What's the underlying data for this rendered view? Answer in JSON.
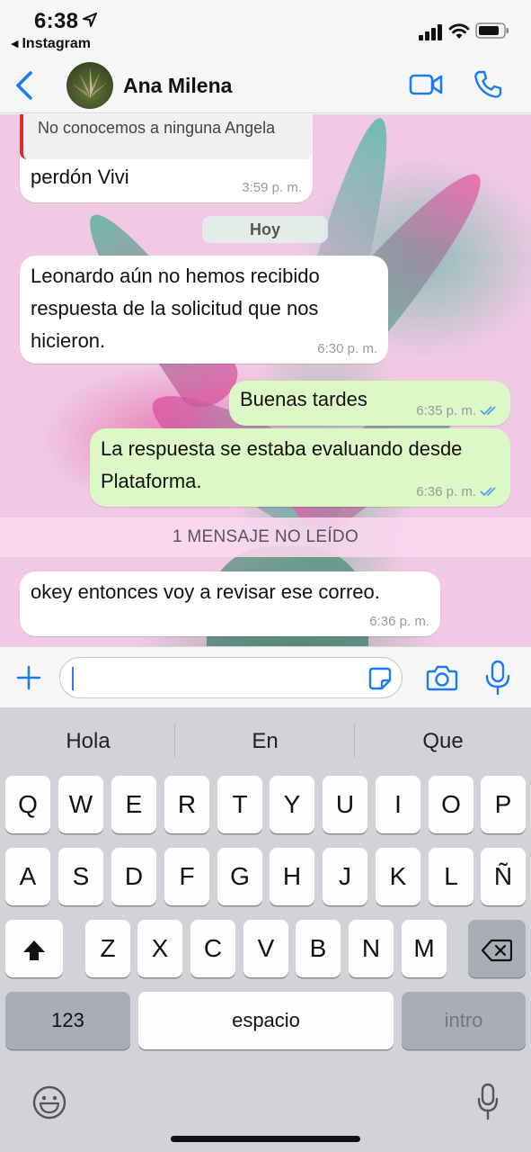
{
  "status_bar": {
    "time": "6:38",
    "back_app": "Instagram"
  },
  "header": {
    "contact_name": "Ana Milena"
  },
  "chat": {
    "quoted_text": "No conocemos a ninguna Angela",
    "day_separator": "Hoy",
    "unread_separator": "1 MENSAJE NO LEÍDO",
    "messages": [
      {
        "direction": "in",
        "lines": [
          "perdón Vivi"
        ],
        "time": "3:59 p. m."
      },
      {
        "direction": "in",
        "lines": [
          "Leonardo aún no hemos recibido",
          "respuesta de la solicitud que nos",
          "hicieron."
        ],
        "time": "6:30 p. m."
      },
      {
        "direction": "out",
        "lines": [
          "Buenas tardes"
        ],
        "time": "6:35 p. m.",
        "status": "read"
      },
      {
        "direction": "out",
        "lines": [
          "La respuesta se estaba evaluando desde",
          "Plataforma."
        ],
        "time": "6:36 p. m.",
        "status": "read"
      },
      {
        "direction": "in",
        "lines": [
          "okey entonces voy a revisar ese correo."
        ],
        "time": "6:36 p. m."
      }
    ]
  },
  "input_bar": {
    "value": ""
  },
  "keyboard": {
    "suggestions": [
      "Hola",
      "En",
      "Que"
    ],
    "row1": [
      "Q",
      "W",
      "E",
      "R",
      "T",
      "Y",
      "U",
      "I",
      "O",
      "P"
    ],
    "row2": [
      "A",
      "S",
      "D",
      "F",
      "G",
      "H",
      "J",
      "K",
      "L",
      "Ñ"
    ],
    "row3": [
      "Z",
      "X",
      "C",
      "V",
      "B",
      "N",
      "M"
    ],
    "numbers_key": "123",
    "space_key": "espacio",
    "return_key": "intro"
  },
  "colors": {
    "accent": "#1a7cf0",
    "outgoing_bubble": "#dcf8c6",
    "incoming_bubble": "#ffffff",
    "read_ticks": "#4fa3e8",
    "quote_bar": "#d63030"
  }
}
